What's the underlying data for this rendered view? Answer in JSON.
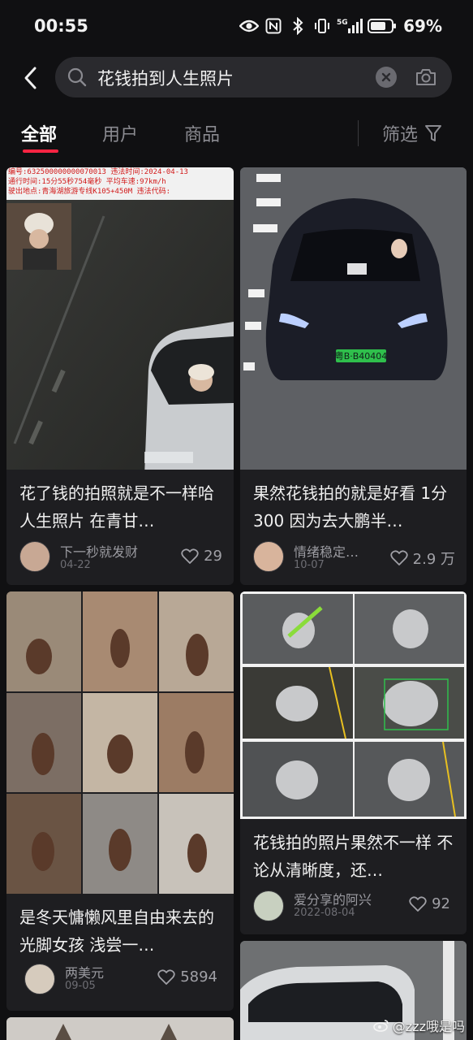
{
  "status_bar": {
    "time": "00:55",
    "network": "5G",
    "battery": "69%"
  },
  "search": {
    "query": "花钱拍到人生照片"
  },
  "tabs": [
    {
      "label": "全部",
      "active": true
    },
    {
      "label": "用户",
      "active": false
    },
    {
      "label": "商品",
      "active": false
    }
  ],
  "filter": {
    "label": "筛选"
  },
  "colors": {
    "accent": "#ff2442",
    "background": "#101012",
    "card": "#1e1e21"
  },
  "cards": [
    {
      "title": "花了钱的拍照就是不一样哈 人生照片 在青甘…",
      "author": "下一秒就发财",
      "date": "04-22",
      "likes": "29",
      "overlay": {
        "line1": "编号:632500000000070013   违法时间:2024-04-13",
        "line2": "通行时间:15分55秒754毫秒  平均车速:97km/h",
        "line3": "驶出地点:青海湖旅游专线K105+450M  违法代码:"
      }
    },
    {
      "title": "果然花钱拍的就是好看 1分300 因为去大鹏半…",
      "author": "情绪稳定…",
      "date": "10-07",
      "likes": "2.9 万",
      "plate": "粤B·B40404"
    },
    {
      "title": "是冬天慵懒风里自由来去的光脚女孩 浅尝一…",
      "author": "两美元",
      "date": "09-05",
      "likes": "5894"
    },
    {
      "title": "花钱拍的照片果然不一样 不论从清晰度，还…",
      "author": "爱分享的阿兴",
      "date": "2022-08-04",
      "likes": "92"
    }
  ],
  "watermark": "@zzz哦是吗"
}
